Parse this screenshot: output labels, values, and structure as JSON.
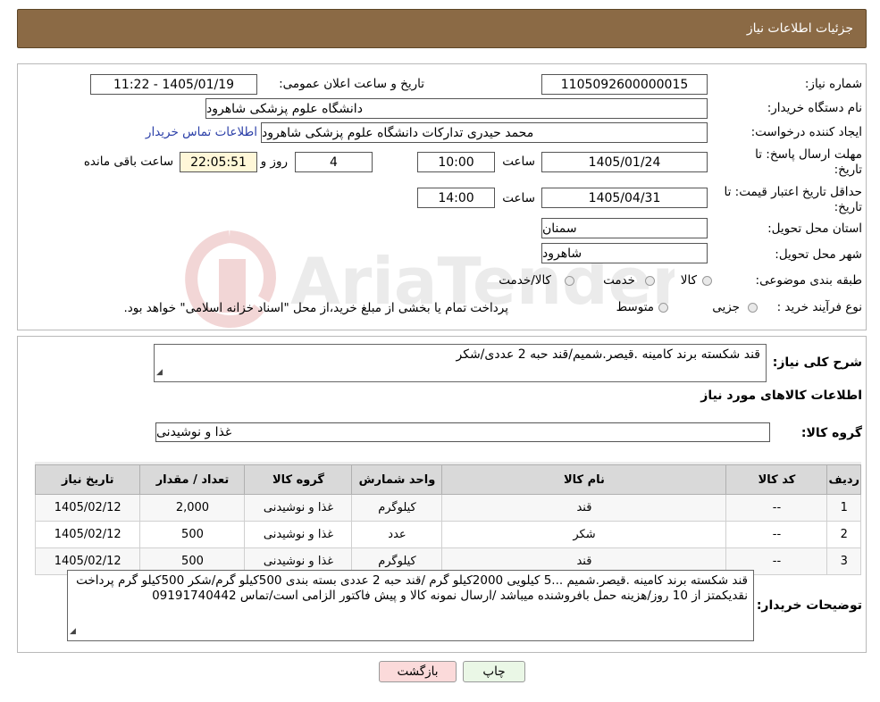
{
  "header": {
    "title": "جزئیات اطلاعات نیاز"
  },
  "form": {
    "need_number_label": "شماره نیاز:",
    "need_number": "1105092600000015",
    "announce_label": "تاریخ و ساعت اعلان عمومی:",
    "announce_value": "1405/01/19 - 11:22",
    "buyer_org_label": "نام دستگاه خریدار:",
    "buyer_org": "دانشگاه علوم پزشکی شاهرود",
    "creator_label": "ایجاد کننده درخواست:",
    "creator": "محمد حیدری تدارکات دانشگاه علوم پزشکی شاهرود",
    "contact_link": "اطلاعات تماس خریدار",
    "deadline_label_1": "مهلت ارسال پاسخ: تا",
    "deadline_label_2": "تاریخ:",
    "deadline_date": "1405/01/24",
    "hour_label": "ساعت",
    "deadline_time": "10:00",
    "days_value": "4",
    "days_label": "روز و",
    "remaining_time": "22:05:51",
    "remaining_label": "ساعت باقی مانده",
    "validity_label_1": "حداقل تاریخ اعتبار قیمت: تا",
    "validity_label_2": "تاریخ:",
    "validity_date": "1405/04/31",
    "validity_time": "14:00",
    "province_label": "استان محل تحویل:",
    "province": "سمنان",
    "city_label": "شهر محل تحویل:",
    "city": "شاهرود",
    "category_label": "طبقه بندی موضوعی:",
    "category_options": [
      "کالا",
      "خدمت",
      "کالا/خدمت"
    ],
    "process_label": "نوع فرآیند خرید :",
    "process_options": [
      "جزیی",
      "متوسط"
    ],
    "process_note": "پرداخت تمام یا بخشی از مبلغ خرید،از محل \"اسناد خزانه اسلامی\" خواهد بود."
  },
  "summary": {
    "desc_label": "شرح کلی نیاز:",
    "desc_value": "قند شکسته برند کامینه .قیصر.شمیم/قند حبه 2 عددی/شکر",
    "goods_info_title": "اطلاعات کالاهای مورد نیاز",
    "goods_group_label": "گروه کالا:",
    "goods_group_value": "غذا و نوشیدنی"
  },
  "table": {
    "headers": [
      "ردیف",
      "کد کالا",
      "نام کالا",
      "واحد شمارش",
      "گروه کالا",
      "تعداد / مقدار",
      "تاریخ نیاز"
    ],
    "rows": [
      {
        "row": "1",
        "code": "--",
        "name": "قند",
        "unit": "کیلوگرم",
        "group": "غذا و نوشیدنی",
        "qty": "2,000",
        "date": "1405/02/12"
      },
      {
        "row": "2",
        "code": "--",
        "name": "شکر",
        "unit": "عدد",
        "group": "غذا و نوشیدنی",
        "qty": "500",
        "date": "1405/02/12"
      },
      {
        "row": "3",
        "code": "--",
        "name": "قند",
        "unit": "کیلوگرم",
        "group": "غذا و نوشیدنی",
        "qty": "500",
        "date": "1405/02/12"
      }
    ]
  },
  "buyer_notes": {
    "label": "توضیحات خریدار:",
    "text": "قند شکسته برند کامینه .قیصر.شمیم ...5 کیلویی 2000کیلو گرم /قند حبه 2 عددی بسته بندی 500کیلو گرم/شکر 500کیلو گرم پرداخت نقدیکمتز از 10 روز/هزینه حمل بافروشنده میباشد /ارسال نمونه کالا و پیش فاکتور الزامی است/تماس 09191740442"
  },
  "buttons": {
    "print": "چاپ",
    "back": "بازگشت"
  },
  "watermark": {
    "text": "AriaTender.neT"
  },
  "colors": {
    "header_bg": "#8b6a45",
    "time_bg": "#fff7d8",
    "print_bg": "#eaf7e6",
    "back_bg": "#fbdada",
    "link": "#2b3fa8"
  }
}
